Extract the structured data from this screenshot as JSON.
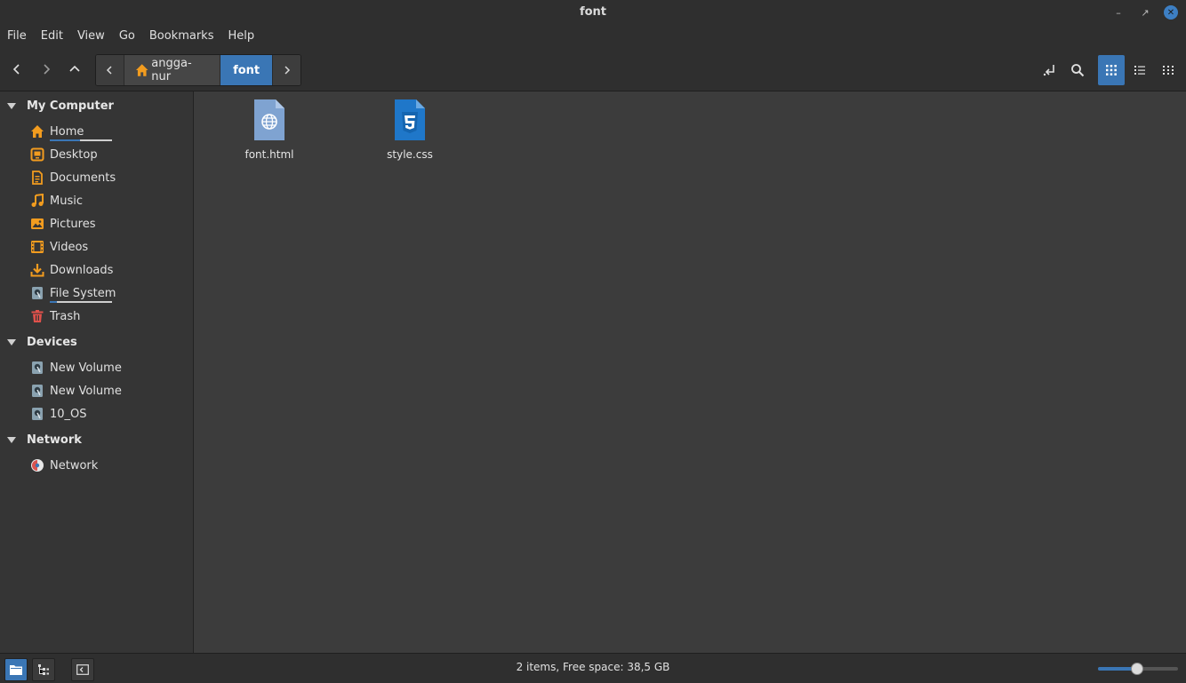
{
  "window": {
    "title": "font"
  },
  "menubar": [
    "File",
    "Edit",
    "View",
    "Go",
    "Bookmarks",
    "Help"
  ],
  "breadcrumb": {
    "items": [
      "angga-nur",
      "font"
    ]
  },
  "sidebar": {
    "sections": [
      {
        "label": "My Computer"
      },
      {
        "label": "Devices"
      },
      {
        "label": "Network"
      }
    ],
    "my_computer": [
      "Home",
      "Desktop",
      "Documents",
      "Music",
      "Pictures",
      "Videos",
      "Downloads",
      "File System",
      "Trash"
    ],
    "devices": [
      "New Volume",
      "New Volume",
      "10_OS"
    ],
    "network": [
      "Network"
    ]
  },
  "files": [
    {
      "name": "font.html",
      "icon": "html-file-icon"
    },
    {
      "name": "style.css",
      "icon": "css-file-icon"
    }
  ],
  "status": {
    "text": "2 items, Free space: 38,5 GB",
    "zoom_fraction": 0.48
  },
  "colors": {
    "accent": "#3a76b5",
    "folder_orange": "#f29c1f",
    "trash_red": "#e0514b"
  }
}
